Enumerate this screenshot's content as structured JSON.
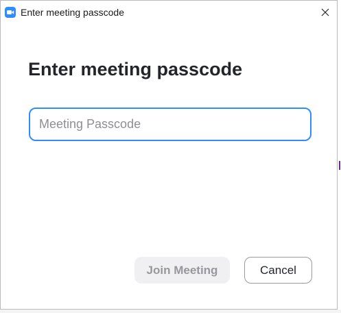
{
  "window": {
    "title": "Enter meeting passcode",
    "app_icon": "zoom-camera-icon",
    "close_icon": "close-icon"
  },
  "main": {
    "heading": "Enter meeting passcode",
    "passcode_input": {
      "value": "",
      "placeholder": "Meeting Passcode"
    }
  },
  "actions": {
    "join_label": "Join Meeting",
    "join_enabled": false,
    "cancel_label": "Cancel"
  },
  "colors": {
    "accent": "#2d8cff",
    "heading_text": "#23252b",
    "disabled_button_bg": "#f0f0f2",
    "disabled_button_text": "#97979d"
  }
}
